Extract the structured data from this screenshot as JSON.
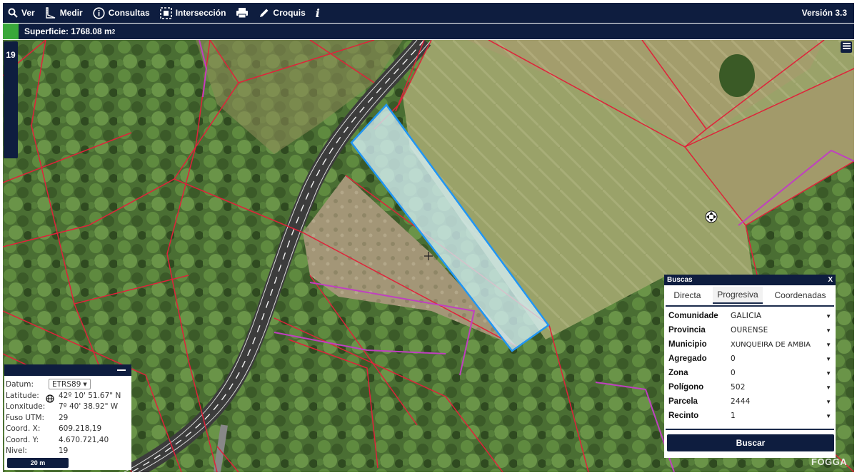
{
  "toolbar": {
    "items": [
      {
        "label": "Ver",
        "icon": "search-icon"
      },
      {
        "label": "Medir",
        "icon": "ruler-icon"
      },
      {
        "label": "Consultas",
        "icon": "info-circle-icon"
      },
      {
        "label": "Intersección",
        "icon": "intersection-icon"
      },
      {
        "label": "",
        "icon": "print-icon"
      },
      {
        "label": "Croquis",
        "icon": "pencil-icon"
      },
      {
        "label": "",
        "icon": "info-icon"
      }
    ],
    "version": "Versión 3.3"
  },
  "surface": {
    "label": "Superficie: 1768.08 m",
    "unit_exp": "2",
    "swatch_color": "#3aa83a"
  },
  "zoom": {
    "level": "19"
  },
  "coords": {
    "datum_label": "Datum:",
    "datum_value": "ETRS89",
    "rows": [
      {
        "label": "Latitude:",
        "value": "42º 10' 51.67\" N"
      },
      {
        "label": "Lonxitude:",
        "value": "7º 40' 38.92\" W"
      },
      {
        "label": "Fuso UTM:",
        "value": "29"
      },
      {
        "label": "Coord. X:",
        "value": "609.218,19"
      },
      {
        "label": "Coord. Y:",
        "value": "4.670.721,40"
      },
      {
        "label": "Nivel:",
        "value": "19"
      }
    ],
    "scale": "20 m"
  },
  "search": {
    "title": "Buscas",
    "close": "X",
    "tabs": [
      "Directa",
      "Progresiva",
      "Coordenadas"
    ],
    "active_tab": 1,
    "fields": [
      {
        "label": "Comunidade",
        "value": "GALICIA"
      },
      {
        "label": "Provincia",
        "value": "OURENSE"
      },
      {
        "label": "Municipio",
        "value": "XUNQUEIRA DE AMBIA"
      },
      {
        "label": "Agregado",
        "value": "0"
      },
      {
        "label": "Zona",
        "value": "0"
      },
      {
        "label": "Polígono",
        "value": "502"
      },
      {
        "label": "Parcela",
        "value": "2444"
      },
      {
        "label": "Recinto",
        "value": "1"
      }
    ],
    "button": "Buscar"
  },
  "watermark": "FOGGA",
  "colors": {
    "toolbar_bg": "#0e1d3f",
    "parcel_lines": "#e0223a",
    "selection": "#2196f3",
    "boundary": "#c040c0"
  }
}
